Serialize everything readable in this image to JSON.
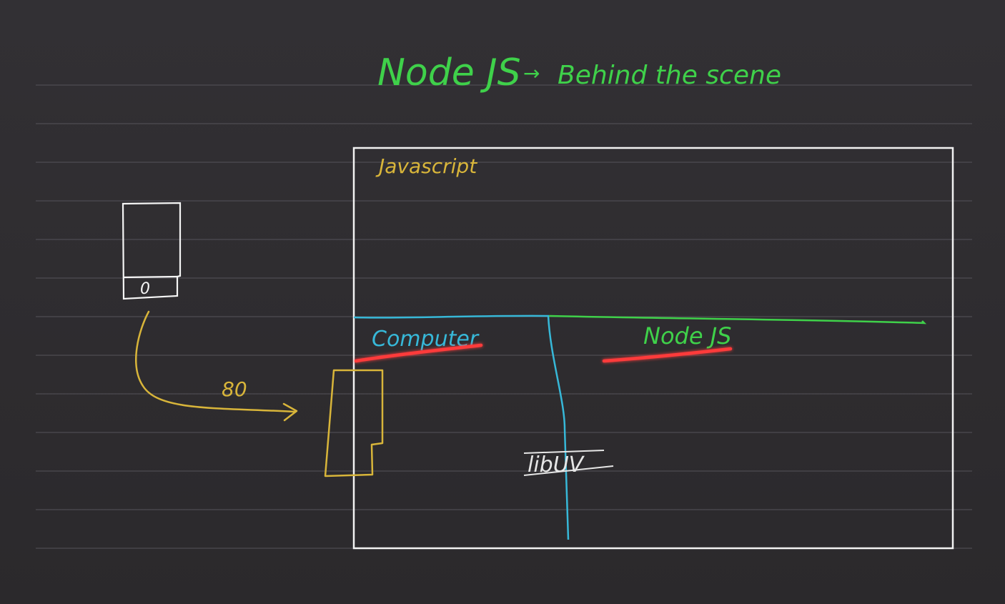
{
  "title": {
    "main": "Node JS",
    "arrow": "→",
    "rest": "Behind the scene"
  },
  "labels": {
    "javascript": "Javascript",
    "computer": "Computer",
    "nodejs": "Node JS",
    "libuv": "libUV",
    "port": "80",
    "phone_button": "0"
  },
  "colors": {
    "background": "#2f2d30",
    "ruled_lines": "#55535a",
    "title_green": "#3fd14a",
    "frame_white": "#f2f2f2",
    "javascript_yellow": "#d8b53a",
    "computer_cyan": "#37b8d8",
    "nodejs_green": "#3fd14a",
    "underline_red": "#ff2a2a",
    "phone_white": "#f5f5f5",
    "arrow_yellow": "#d8b53a",
    "libuv_white": "#e6e6e6"
  }
}
